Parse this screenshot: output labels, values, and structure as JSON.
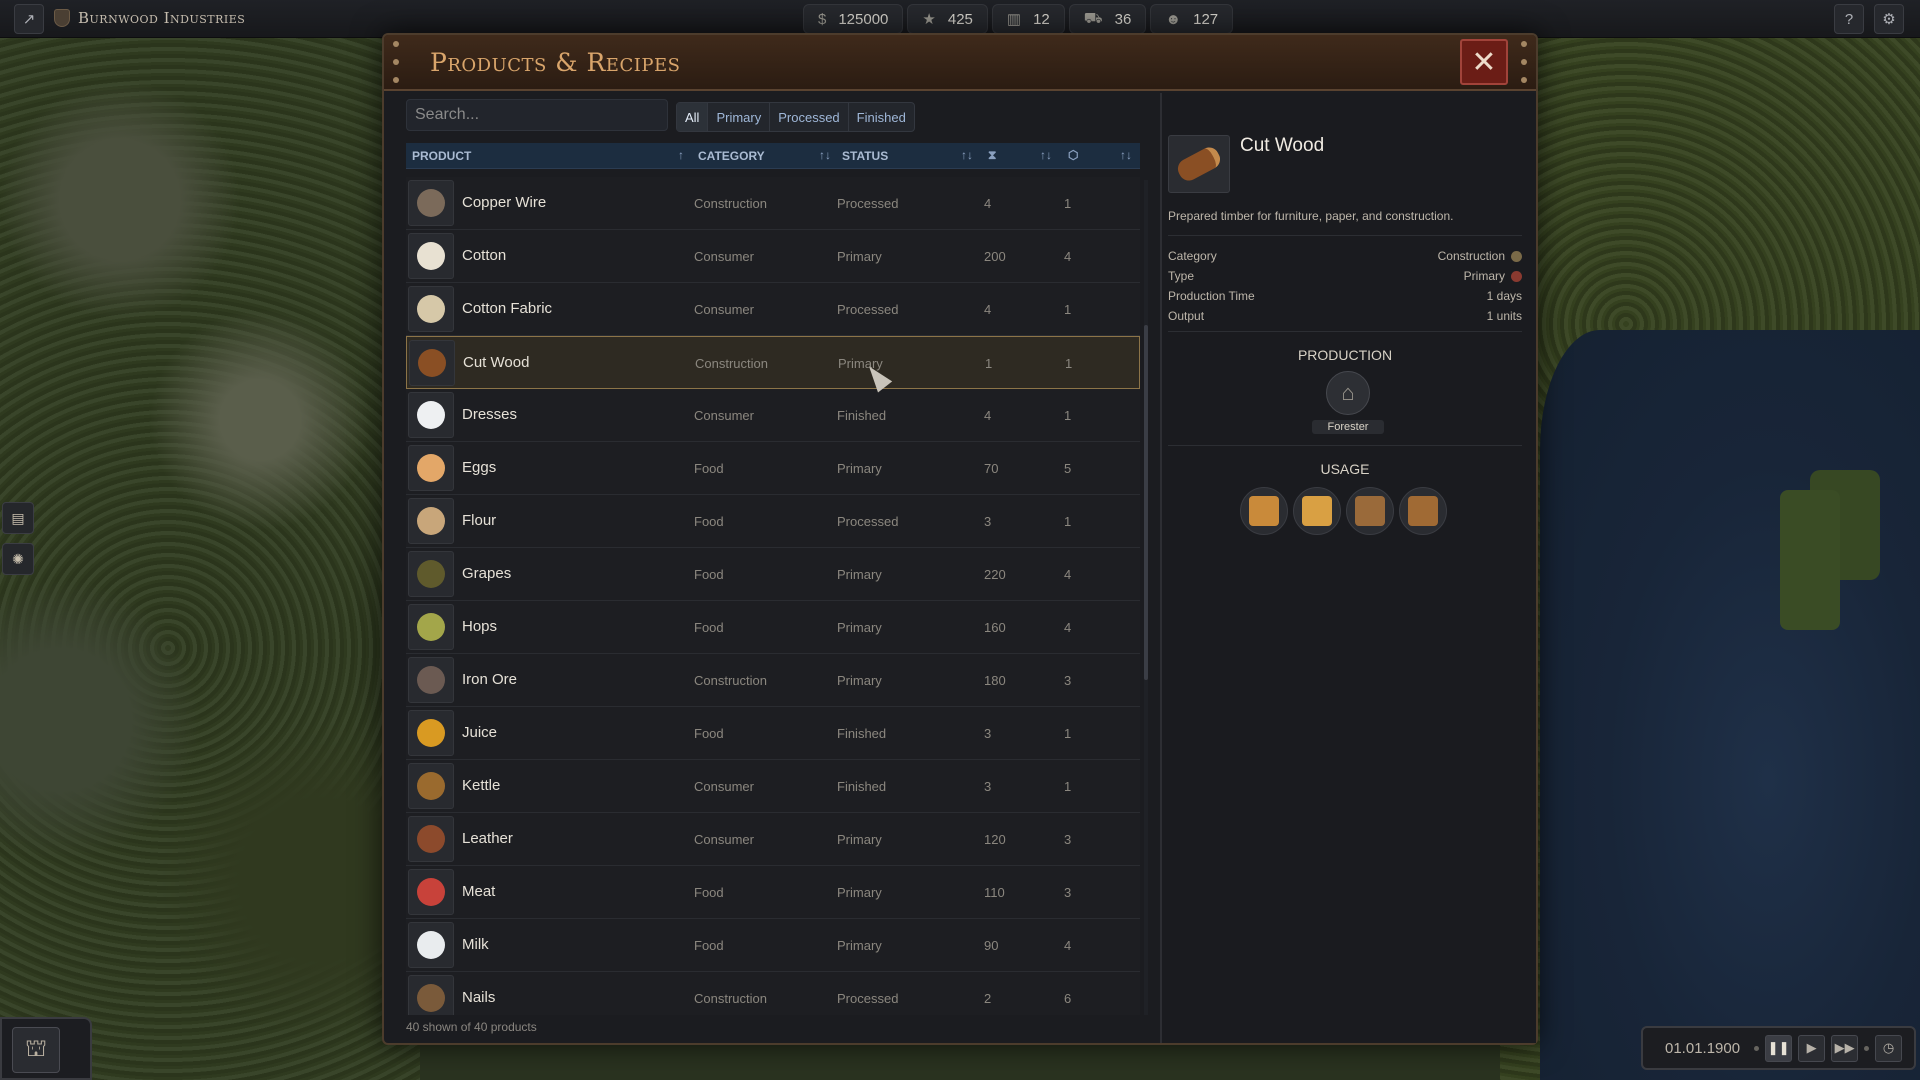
{
  "company": {
    "name": "Burnwood Industries"
  },
  "resources": [
    {
      "icon": "dollar-icon",
      "glyph": "$",
      "value": "125000"
    },
    {
      "icon": "star-icon",
      "glyph": "★",
      "value": "425"
    },
    {
      "icon": "factory-icon",
      "glyph": "▥",
      "value": "12"
    },
    {
      "icon": "truck-icon",
      "glyph": "⛟",
      "value": "36"
    },
    {
      "icon": "worker-icon",
      "glyph": "☻",
      "value": "127"
    }
  ],
  "modal": {
    "title": "Products & Recipes",
    "close_glyph": "✕",
    "search": {
      "placeholder": "Search...",
      "value": ""
    },
    "filters": [
      {
        "label": "All",
        "selected": true
      },
      {
        "label": "Primary",
        "selected": false
      },
      {
        "label": "Processed",
        "selected": false
      },
      {
        "label": "Finished",
        "selected": false
      }
    ],
    "columns": {
      "product": "PRODUCT",
      "category": "CATEGORY",
      "status": "STATUS",
      "sort_glyph": "↑↓",
      "sort_asc_glyph": "↑",
      "time_glyph": "⧗",
      "output_glyph": "⬡"
    },
    "rows": [
      {
        "name": "Copper Wire",
        "category": "Construction",
        "status": "Processed",
        "time": "4",
        "output": "1",
        "color": "#7b6a5a",
        "selected": false
      },
      {
        "name": "Cotton",
        "category": "Consumer",
        "status": "Primary",
        "time": "200",
        "output": "4",
        "color": "#e8e1d2",
        "selected": false
      },
      {
        "name": "Cotton Fabric",
        "category": "Consumer",
        "status": "Processed",
        "time": "4",
        "output": "1",
        "color": "#d6c8a8",
        "selected": false
      },
      {
        "name": "Cut Wood",
        "category": "Construction",
        "status": "Primary",
        "time": "1",
        "output": "1",
        "color": "#8a4f24",
        "selected": true
      },
      {
        "name": "Dresses",
        "category": "Consumer",
        "status": "Finished",
        "time": "4",
        "output": "1",
        "color": "#eef0f2",
        "selected": false
      },
      {
        "name": "Eggs",
        "category": "Food",
        "status": "Primary",
        "time": "70",
        "output": "5",
        "color": "#e3a768",
        "selected": false
      },
      {
        "name": "Flour",
        "category": "Food",
        "status": "Processed",
        "time": "3",
        "output": "1",
        "color": "#c8a67a",
        "selected": false
      },
      {
        "name": "Grapes",
        "category": "Food",
        "status": "Primary",
        "time": "220",
        "output": "4",
        "color": "#5f5a2c",
        "selected": false
      },
      {
        "name": "Hops",
        "category": "Food",
        "status": "Primary",
        "time": "160",
        "output": "4",
        "color": "#a3a64a",
        "selected": false
      },
      {
        "name": "Iron Ore",
        "category": "Construction",
        "status": "Primary",
        "time": "180",
        "output": "3",
        "color": "#6b5a52",
        "selected": false
      },
      {
        "name": "Juice",
        "category": "Food",
        "status": "Finished",
        "time": "3",
        "output": "1",
        "color": "#d99a22",
        "selected": false
      },
      {
        "name": "Kettle",
        "category": "Consumer",
        "status": "Finished",
        "time": "3",
        "output": "1",
        "color": "#9a6a2e",
        "selected": false
      },
      {
        "name": "Leather",
        "category": "Consumer",
        "status": "Primary",
        "time": "120",
        "output": "3",
        "color": "#8c4a2c",
        "selected": false
      },
      {
        "name": "Meat",
        "category": "Food",
        "status": "Primary",
        "time": "110",
        "output": "3",
        "color": "#c8423a",
        "selected": false
      },
      {
        "name": "Milk",
        "category": "Food",
        "status": "Primary",
        "time": "90",
        "output": "4",
        "color": "#e9ecee",
        "selected": false
      },
      {
        "name": "Nails",
        "category": "Construction",
        "status": "Processed",
        "time": "2",
        "output": "6",
        "color": "#7a5a3a",
        "selected": false
      }
    ],
    "count_text": "40 shown of 40 products",
    "details": {
      "name": "Cut Wood",
      "description": "Prepared timber for furniture, paper, and construction.",
      "category_label": "Category",
      "category_value": "Construction",
      "category_color": "#7a6a48",
      "type_label": "Type",
      "type_value": "Primary",
      "type_color": "#8a3a30",
      "time_label": "Production Time",
      "time_value": "1 days",
      "output_label": "Output",
      "output_value": "1 units",
      "production_title": "PRODUCTION",
      "producer": "Forester",
      "usage_title": "USAGE",
      "usage_items": [
        {
          "icon": "planks-icon",
          "color": "#c98a3a"
        },
        {
          "icon": "sawdust-icon",
          "color": "#d9a043"
        },
        {
          "icon": "chair-icon",
          "color": "#9a6a3a"
        },
        {
          "icon": "table-icon",
          "color": "#a06a34"
        }
      ]
    }
  },
  "time": {
    "date": "01.01.1900"
  },
  "colors": {
    "accent": "#d9a56b",
    "selection_border": "#8c7448",
    "header_bg": "#1c2d40"
  }
}
